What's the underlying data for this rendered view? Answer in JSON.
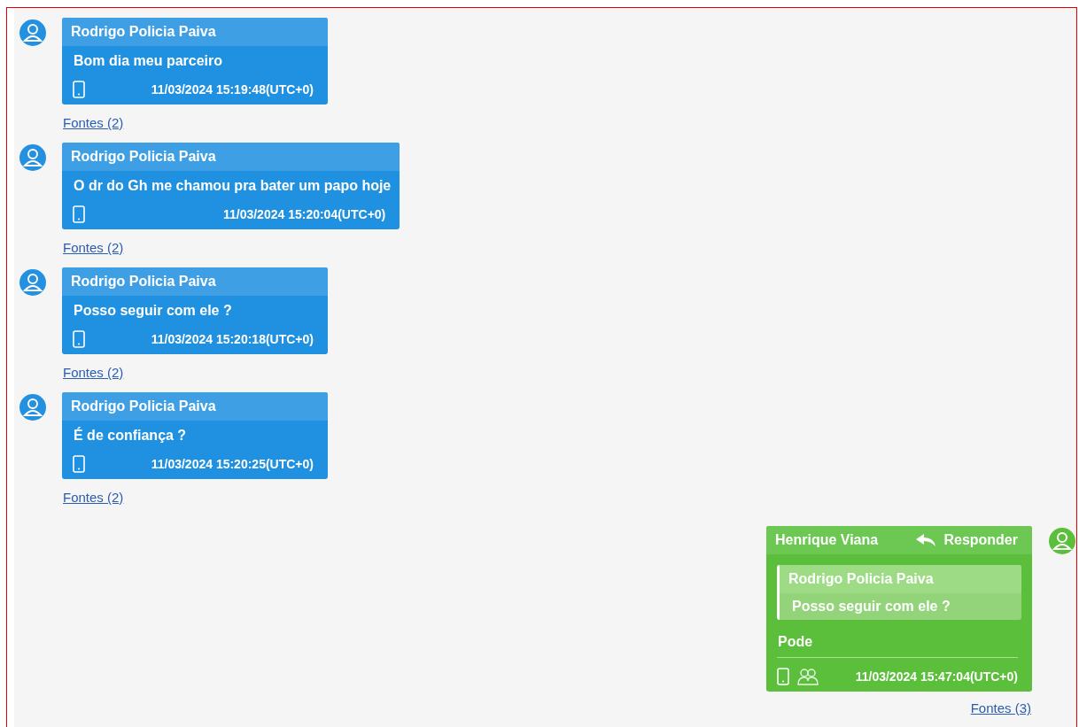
{
  "messages": [
    {
      "kind": "incoming",
      "sender": "Rodrigo Policia Paiva",
      "text": "Bom dia meu parceiro",
      "timestamp": "11/03/2024 15:19:48(UTC+0)",
      "sources": "Fontes (2)"
    },
    {
      "kind": "incoming",
      "sender": "Rodrigo Policia Paiva",
      "text": "O dr do Gh me chamou pra bater um papo hoje",
      "timestamp": "11/03/2024 15:20:04(UTC+0)",
      "sources": "Fontes (2)"
    },
    {
      "kind": "incoming",
      "sender": "Rodrigo Policia Paiva",
      "text": "Posso seguir com ele ?",
      "timestamp": "11/03/2024 15:20:18(UTC+0)",
      "sources": "Fontes (2)"
    },
    {
      "kind": "incoming",
      "sender": "Rodrigo Policia Paiva",
      "text": "É de confiança ?",
      "timestamp": "11/03/2024 15:20:25(UTC+0)",
      "sources": "Fontes (2)"
    },
    {
      "kind": "outgoing",
      "sender": "Henrique Viana",
      "reply_label": "Responder",
      "quote": {
        "sender": "Rodrigo Policia Paiva",
        "text": "Posso seguir com ele ?"
      },
      "text": "Pode",
      "timestamp": "11/03/2024 15:47:04(UTC+0)",
      "sources": "Fontes (3)"
    }
  ]
}
